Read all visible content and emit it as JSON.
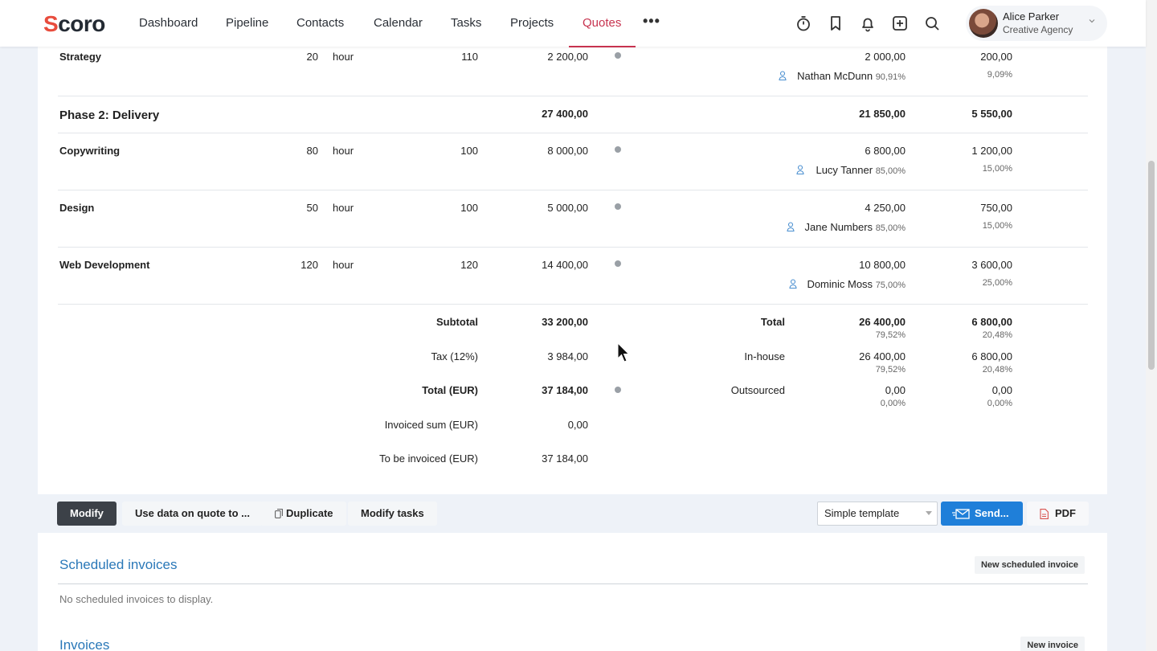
{
  "app": {
    "logo_s": "S",
    "logo_rest": "coro"
  },
  "nav": {
    "items": [
      "Dashboard",
      "Pipeline",
      "Contacts",
      "Calendar",
      "Tasks",
      "Projects",
      "Quotes"
    ],
    "more": "•••",
    "active": "Quotes",
    "accent": "#c7334f"
  },
  "user": {
    "name": "Alice Parker",
    "company": "Creative Agency"
  },
  "rows": {
    "strategy": {
      "name": "Strategy",
      "qty": "20",
      "unit": "hour",
      "price": "110",
      "sum": "2 200,00",
      "cost": "2 000,00",
      "margin": "200,00",
      "person": "Nathan McDunn",
      "person_pct": "90,91%",
      "margin_pct": "9,09%"
    },
    "phase2": {
      "name": "Phase 2: Delivery",
      "sum": "27 400,00",
      "cost": "21 850,00",
      "margin": "5 550,00"
    },
    "copywriting": {
      "name": "Copywriting",
      "qty": "80",
      "unit": "hour",
      "price": "100",
      "sum": "8 000,00",
      "cost": "6 800,00",
      "margin": "1 200,00",
      "person": "Lucy Tanner",
      "person_pct": "85,00%",
      "margin_pct": "15,00%"
    },
    "design": {
      "name": "Design",
      "qty": "50",
      "unit": "hour",
      "price": "100",
      "sum": "5 000,00",
      "cost": "4 250,00",
      "margin": "750,00",
      "person": "Jane Numbers",
      "person_pct": "85,00%",
      "margin_pct": "15,00%"
    },
    "webdev": {
      "name": "Web Development",
      "qty": "120",
      "unit": "hour",
      "price": "120",
      "sum": "14 400,00",
      "cost": "10 800,00",
      "margin": "3 600,00",
      "person": "Dominic Moss",
      "person_pct": "75,00%",
      "margin_pct": "25,00%"
    }
  },
  "summary": {
    "subtotal_label": "Subtotal",
    "subtotal": "33 200,00",
    "tax_label": "Tax (12%)",
    "tax": "3 984,00",
    "total_label": "Total (EUR)",
    "total": "37 184,00",
    "invoiced_label": "Invoiced sum (EUR)",
    "invoiced": "0,00",
    "tobe_label": "To be invoiced (EUR)",
    "tobe": "37 184,00"
  },
  "breakdown": {
    "total_label": "Total",
    "total_cost": "26 400,00",
    "total_cost_pct": "79,52%",
    "total_margin": "6 800,00",
    "total_margin_pct": "20,48%",
    "inhouse_label": "In-house",
    "inhouse_cost": "26 400,00",
    "inhouse_cost_pct": "79,52%",
    "inhouse_margin": "6 800,00",
    "inhouse_margin_pct": "20,48%",
    "outsourced_label": "Outsourced",
    "outsourced_cost": "0,00",
    "outsourced_cost_pct": "0,00%",
    "outsourced_margin": "0,00",
    "outsourced_margin_pct": "0,00%"
  },
  "actions": {
    "modify": "Modify",
    "use_data": "Use data on quote to ...",
    "duplicate": "Duplicate",
    "modify_tasks": "Modify tasks",
    "template": "Simple template",
    "send": "Send...",
    "pdf": "PDF"
  },
  "scheduled": {
    "title": "Scheduled invoices",
    "new_button": "New scheduled invoice",
    "empty": "No scheduled invoices to display."
  },
  "invoices": {
    "title": "Invoices",
    "new_button": "New invoice"
  }
}
